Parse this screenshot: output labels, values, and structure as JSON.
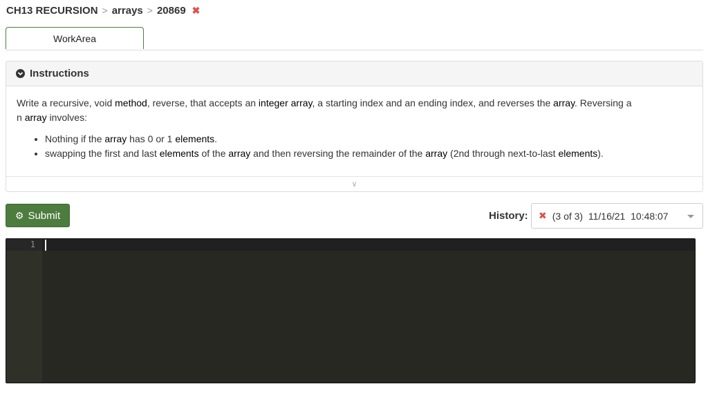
{
  "breadcrumb": {
    "chapter": "CH13 RECURSION",
    "topic": "arrays",
    "exercise": "20869",
    "separator": ">",
    "status_icon": "✖"
  },
  "tabs": [
    {
      "label": "WorkArea"
    }
  ],
  "instructions": {
    "title": "Instructions",
    "paragraph": [
      {
        "t": "Write a recursive, void ",
        "strong": false
      },
      {
        "t": "method",
        "strong": true
      },
      {
        "t": ", reverse, that accepts an ",
        "strong": false
      },
      {
        "t": "integer array",
        "strong": true
      },
      {
        "t": ", a starting index and an ending index, and reverses the ",
        "strong": false
      },
      {
        "t": "array",
        "strong": true
      },
      {
        "t": ". Reversing a",
        "strong": false
      },
      {
        "t": "\nn ",
        "strong": false
      },
      {
        "t": "array",
        "strong": true
      },
      {
        "t": " involves:",
        "strong": false
      }
    ],
    "bullets": [
      [
        {
          "t": "Nothing if the ",
          "strong": false
        },
        {
          "t": "array",
          "strong": true
        },
        {
          "t": " has 0 or 1 ",
          "strong": false
        },
        {
          "t": "elements",
          "strong": true
        },
        {
          "t": ".",
          "strong": false
        }
      ],
      [
        {
          "t": "swapping the first and last ",
          "strong": false
        },
        {
          "t": "elements",
          "strong": true
        },
        {
          "t": " of the ",
          "strong": false
        },
        {
          "t": "array",
          "strong": true
        },
        {
          "t": " and then reversing the remainder of the ",
          "strong": false
        },
        {
          "t": "array",
          "strong": true
        },
        {
          "t": " (2nd through next-to-last ",
          "strong": false
        },
        {
          "t": "elements",
          "strong": true
        },
        {
          "t": ").",
          "strong": false
        }
      ]
    ],
    "expander_icon": "∨"
  },
  "submit": {
    "label": "Submit",
    "icon": "⚙"
  },
  "history": {
    "label": "History:",
    "selected": "(3 of 3)  11/16/21  10:48:07",
    "status_icon": "✖"
  },
  "editor": {
    "line_numbers": [
      "1"
    ],
    "content": ""
  },
  "colors": {
    "accent_green": "#4d7c3f",
    "error_red": "#d9534f",
    "editor_bg": "#272822",
    "gutter_bg": "#2f3129"
  }
}
